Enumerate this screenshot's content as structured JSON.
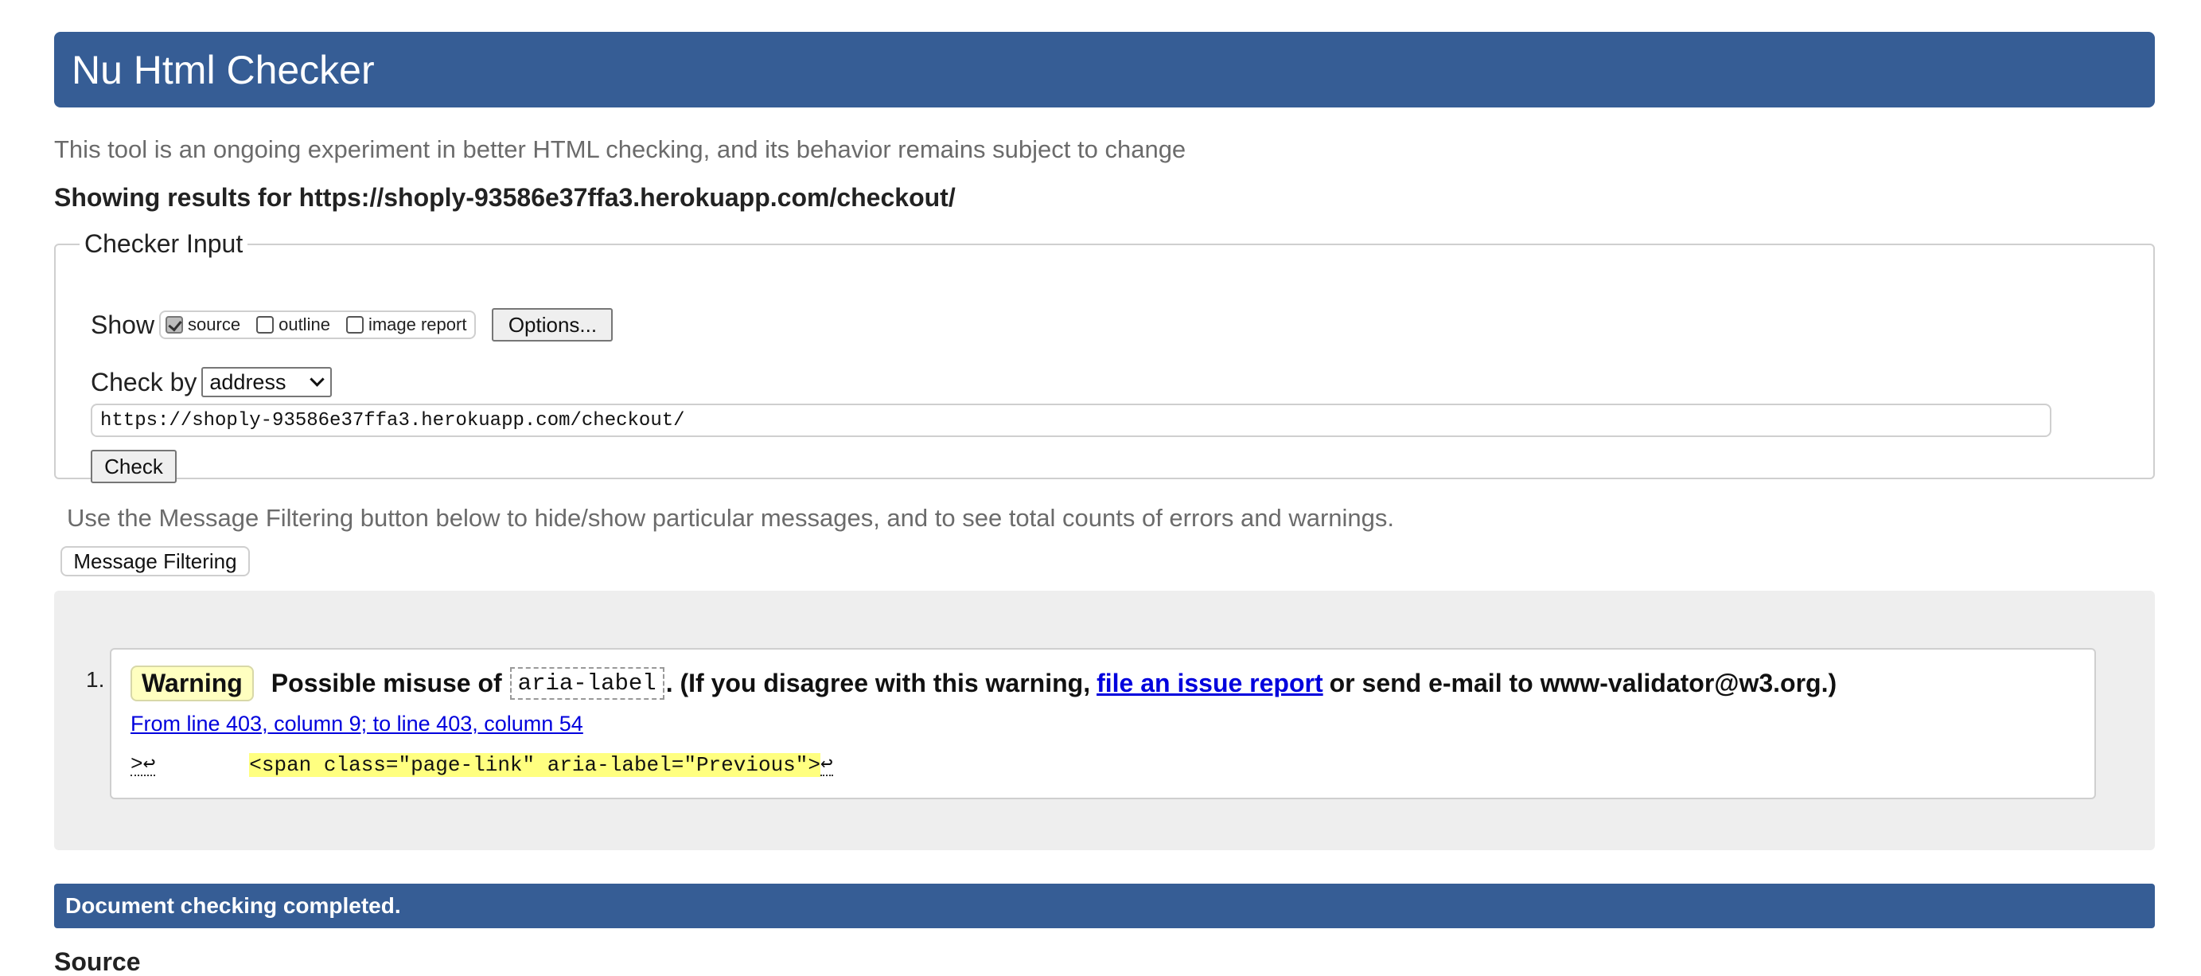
{
  "app": {
    "title": "Nu Html Checker",
    "intro": "This tool is an ongoing experiment in better HTML checking, and its behavior remains subject to change",
    "results_for_label": "Showing results for",
    "checked_url": "https://shoply-93586e37ffa3.herokuapp.com/checkout/"
  },
  "checker_input": {
    "legend": "Checker Input",
    "show_label": "Show",
    "show_options": [
      {
        "label": "source",
        "checked": true
      },
      {
        "label": "outline",
        "checked": false
      },
      {
        "label": "image report",
        "checked": false
      }
    ],
    "options_button": "Options...",
    "check_by_label": "Check by",
    "check_by_value": "address",
    "url_value": "https://shoply-93586e37ffa3.herokuapp.com/checkout/",
    "check_button": "Check"
  },
  "filtering": {
    "note": "Use the Message Filtering button below to hide/show particular messages, and to see total counts of errors and warnings.",
    "button": "Message Filtering"
  },
  "messages": [
    {
      "number": "1.",
      "type": "Warning",
      "text_before": "Possible misuse of",
      "code": "aria-label",
      "text_middle": ". (If you disagree with this warning,",
      "link_text": "file an issue report",
      "text_after": "or send e-mail to www-validator@w3.org.)",
      "location": "From line 403, column 9; to line 403, column 54",
      "extract_prefix": ">↩",
      "extract_highlight": "<span class=\"page-link\" aria-label=\"Previous\">",
      "extract_suffix": "↩"
    }
  ],
  "status": {
    "completed": "Document checking completed."
  },
  "source": {
    "heading": "Source"
  },
  "colors": {
    "header_blue": "#365d95",
    "warning_badge": "#ffffc0",
    "code_highlight": "#ffff80",
    "link": "#0000dd"
  }
}
